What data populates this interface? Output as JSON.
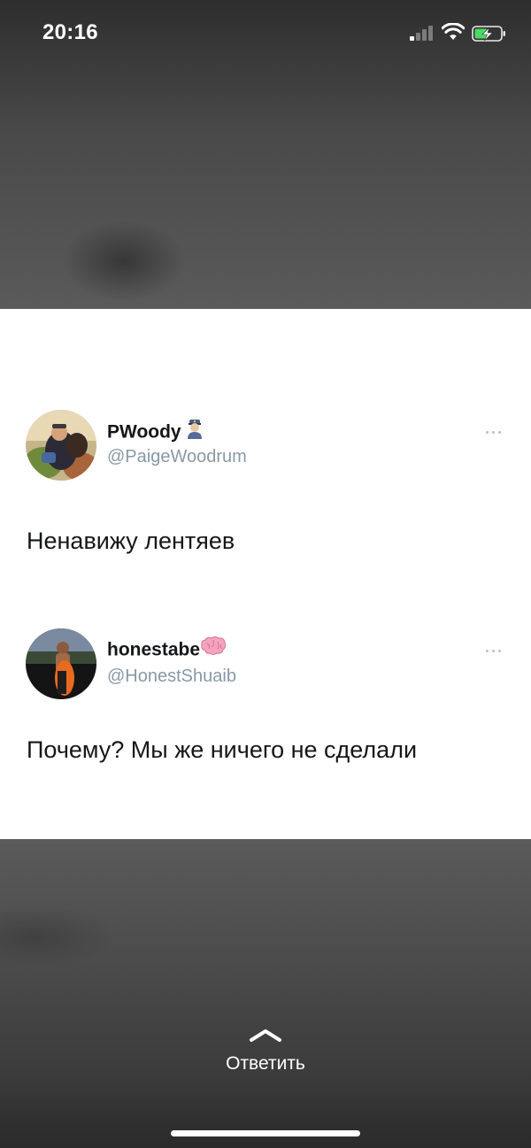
{
  "status_bar": {
    "time": "20:16",
    "signal_icon": "cellular-signal-icon",
    "signal_bars_active": 1,
    "signal_bars_total": 4,
    "wifi_icon": "wifi-icon",
    "battery_icon": "battery-charging-icon",
    "battery_color": "#4cd964"
  },
  "tweets": [
    {
      "display_name": "PWoody",
      "emoji_icon": "police-officer-emoji-icon",
      "handle": "@PaigeWoodrum",
      "text": "Ненавижу лентяев",
      "more_icon": "more-options-icon"
    },
    {
      "display_name": "honestabe",
      "emoji_icon": "brain-emoji-icon",
      "handle": "@HonestShuaib",
      "text": "Почему? Мы же ничего не сделали",
      "more_icon": "more-options-icon"
    }
  ],
  "reply": {
    "icon": "chevron-up-icon",
    "label": "Ответить"
  },
  "colors": {
    "card_background": "#ffffff",
    "text_primary": "#14171a",
    "text_secondary": "#8899a6",
    "overlay_background": "#4a4a4a"
  }
}
